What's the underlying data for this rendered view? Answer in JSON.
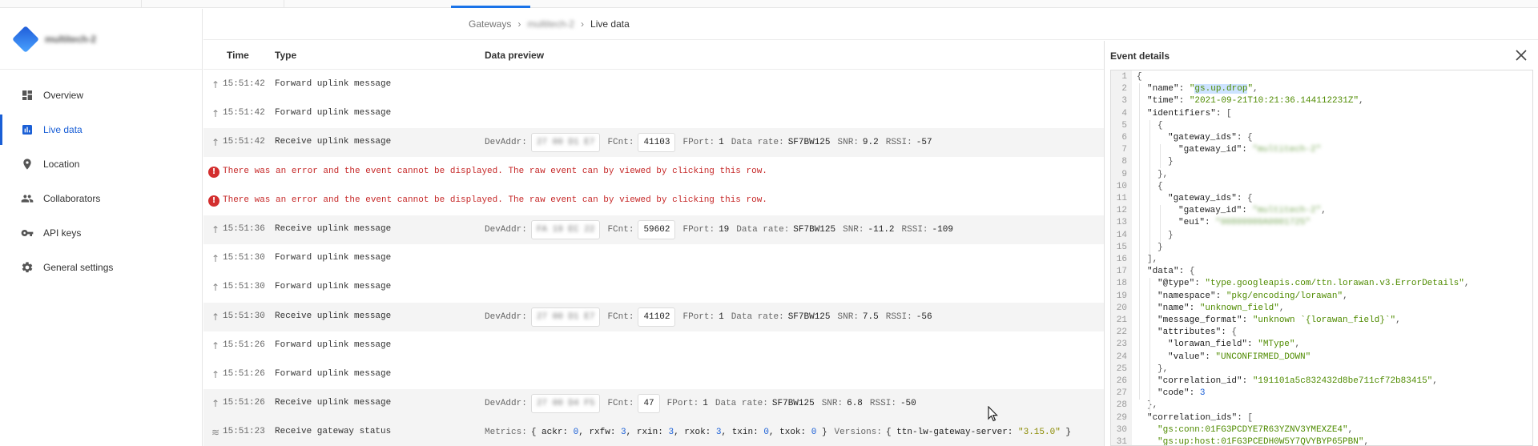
{
  "sidebar": {
    "brand_name": "multitech-2",
    "items": [
      {
        "label": "Overview",
        "icon": "dashboard-icon",
        "active": false
      },
      {
        "label": "Live data",
        "icon": "bar-chart-icon",
        "active": true
      },
      {
        "label": "Location",
        "icon": "location-pin-icon",
        "active": false
      },
      {
        "label": "Collaborators",
        "icon": "people-icon",
        "active": false
      },
      {
        "label": "API keys",
        "icon": "key-icon",
        "active": false
      },
      {
        "label": "General settings",
        "icon": "gear-icon",
        "active": false
      }
    ]
  },
  "breadcrumb": {
    "items": [
      "Gateways",
      "multitech-2",
      "Live data"
    ]
  },
  "table": {
    "headers": {
      "time": "Time",
      "type": "Type",
      "preview": "Data preview"
    },
    "rows": [
      {
        "kind": "event",
        "icon": "arrow-up-icon",
        "time": "15:51:42",
        "type": "Forward uplink message"
      },
      {
        "kind": "event",
        "icon": "arrow-up-icon",
        "time": "15:51:42",
        "type": "Forward uplink message"
      },
      {
        "kind": "uplink",
        "icon": "arrow-up-icon",
        "time": "15:51:42",
        "type": "Receive uplink message",
        "devaddr": "27 00 D1 E7",
        "fcnt": "41103",
        "fport": "1",
        "datarate": "SF7BW125",
        "snr": "9.2",
        "rssi": "-57"
      },
      {
        "kind": "error",
        "text": "There was an error and the event cannot be displayed. The raw event can by viewed by clicking this row."
      },
      {
        "kind": "error",
        "text": "There was an error and the event cannot be displayed. The raw event can by viewed by clicking this row."
      },
      {
        "kind": "uplink",
        "icon": "arrow-up-icon",
        "time": "15:51:36",
        "type": "Receive uplink message",
        "devaddr": "FA 19 EC 22",
        "fcnt": "59602",
        "fport": "19",
        "datarate": "SF7BW125",
        "snr": "-11.2",
        "rssi": "-109"
      },
      {
        "kind": "event",
        "icon": "arrow-up-icon",
        "time": "15:51:30",
        "type": "Forward uplink message"
      },
      {
        "kind": "event",
        "icon": "arrow-up-icon",
        "time": "15:51:30",
        "type": "Forward uplink message"
      },
      {
        "kind": "uplink",
        "icon": "arrow-up-icon",
        "time": "15:51:30",
        "type": "Receive uplink message",
        "devaddr": "27 00 D1 E7",
        "fcnt": "41102",
        "fport": "1",
        "datarate": "SF7BW125",
        "snr": "7.5",
        "rssi": "-56"
      },
      {
        "kind": "event",
        "icon": "arrow-up-icon",
        "time": "15:51:26",
        "type": "Forward uplink message"
      },
      {
        "kind": "event",
        "icon": "arrow-up-icon",
        "time": "15:51:26",
        "type": "Forward uplink message"
      },
      {
        "kind": "uplink",
        "icon": "arrow-up-icon",
        "time": "15:51:26",
        "type": "Receive uplink message",
        "devaddr": "27 00 D4 F5",
        "fcnt": "47",
        "fport": "1",
        "datarate": "SF7BW125",
        "snr": "6.8",
        "rssi": "-50"
      },
      {
        "kind": "status",
        "icon": "wifi-icon",
        "time": "15:51:23",
        "type": "Receive gateway status",
        "metrics": {
          "ackr": "0",
          "rxfw": "3",
          "rxin": "3",
          "rxok": "3",
          "txin": "0",
          "txok": "0"
        },
        "version_key": "ttn-lw-gateway-server",
        "version_value": "\"3.15.0\""
      }
    ],
    "labels": {
      "devaddr": "DevAddr:",
      "fcnt": "FCnt:",
      "fport": "FPort:",
      "datarate": "Data rate:",
      "snr": "SNR:",
      "rssi": "RSSI:",
      "metrics": "Metrics:",
      "versions": "Versions:"
    }
  },
  "event_details": {
    "title": "Event details",
    "lines": [
      {
        "n": "1",
        "indent": 0,
        "parts": [
          [
            "p",
            "{"
          ]
        ]
      },
      {
        "n": "2",
        "indent": 1,
        "parts": [
          [
            "k",
            "\"name\": "
          ],
          [
            "s",
            "\""
          ],
          [
            "hl",
            "gs.up.drop"
          ],
          [
            "s",
            "\""
          ],
          [
            "p",
            ","
          ]
        ]
      },
      {
        "n": "3",
        "indent": 1,
        "parts": [
          [
            "k",
            "\"time\": "
          ],
          [
            "s",
            "\"2021-09-21T10:21:36.144112231Z\""
          ],
          [
            "p",
            ","
          ]
        ]
      },
      {
        "n": "4",
        "indent": 1,
        "parts": [
          [
            "k",
            "\"identifiers\": "
          ],
          [
            "p",
            "["
          ]
        ]
      },
      {
        "n": "5",
        "indent": 2,
        "parts": [
          [
            "p",
            "{"
          ]
        ]
      },
      {
        "n": "6",
        "indent": 3,
        "parts": [
          [
            "k",
            "\"gateway_ids\": "
          ],
          [
            "p",
            "{"
          ]
        ]
      },
      {
        "n": "7",
        "indent": 4,
        "parts": [
          [
            "k",
            "\"gateway_id\": "
          ],
          [
            "bl",
            "\"multitech-2\""
          ]
        ]
      },
      {
        "n": "8",
        "indent": 3,
        "parts": [
          [
            "p",
            "}"
          ]
        ]
      },
      {
        "n": "9",
        "indent": 2,
        "parts": [
          [
            "p",
            "},"
          ]
        ]
      },
      {
        "n": "10",
        "indent": 2,
        "parts": [
          [
            "p",
            "{"
          ]
        ]
      },
      {
        "n": "11",
        "indent": 3,
        "parts": [
          [
            "k",
            "\"gateway_ids\": "
          ],
          [
            "p",
            "{"
          ]
        ]
      },
      {
        "n": "12",
        "indent": 4,
        "parts": [
          [
            "k",
            "\"gateway_id\": "
          ],
          [
            "bl",
            "\"multitech-2\""
          ],
          [
            "p",
            ","
          ]
        ]
      },
      {
        "n": "13",
        "indent": 4,
        "parts": [
          [
            "k",
            "\"eui\": "
          ],
          [
            "bl",
            "\"00800000A0001725\""
          ]
        ]
      },
      {
        "n": "14",
        "indent": 3,
        "parts": [
          [
            "p",
            "}"
          ]
        ]
      },
      {
        "n": "15",
        "indent": 2,
        "parts": [
          [
            "p",
            "}"
          ]
        ]
      },
      {
        "n": "16",
        "indent": 1,
        "parts": [
          [
            "p",
            "],"
          ]
        ]
      },
      {
        "n": "17",
        "indent": 1,
        "parts": [
          [
            "k",
            "\"data\": "
          ],
          [
            "p",
            "{"
          ]
        ]
      },
      {
        "n": "18",
        "indent": 2,
        "parts": [
          [
            "k",
            "\"@type\": "
          ],
          [
            "s",
            "\"type.googleapis.com/ttn.lorawan.v3.ErrorDetails\""
          ],
          [
            "p",
            ","
          ]
        ]
      },
      {
        "n": "19",
        "indent": 2,
        "parts": [
          [
            "k",
            "\"namespace\": "
          ],
          [
            "s",
            "\"pkg/encoding/lorawan\""
          ],
          [
            "p",
            ","
          ]
        ]
      },
      {
        "n": "20",
        "indent": 2,
        "parts": [
          [
            "k",
            "\"name\": "
          ],
          [
            "s",
            "\"unknown_field\""
          ],
          [
            "p",
            ","
          ]
        ]
      },
      {
        "n": "21",
        "indent": 2,
        "parts": [
          [
            "k",
            "\"message_format\": "
          ],
          [
            "s",
            "\"unknown `{lorawan_field}`\""
          ],
          [
            "p",
            ","
          ]
        ]
      },
      {
        "n": "22",
        "indent": 2,
        "parts": [
          [
            "k",
            "\"attributes\": "
          ],
          [
            "p",
            "{"
          ]
        ]
      },
      {
        "n": "23",
        "indent": 3,
        "parts": [
          [
            "k",
            "\"lorawan_field\": "
          ],
          [
            "s",
            "\"MType\""
          ],
          [
            "p",
            ","
          ]
        ]
      },
      {
        "n": "24",
        "indent": 3,
        "parts": [
          [
            "k",
            "\"value\": "
          ],
          [
            "s",
            "\"UNCONFIRMED_DOWN\""
          ]
        ]
      },
      {
        "n": "25",
        "indent": 2,
        "parts": [
          [
            "p",
            "},"
          ]
        ]
      },
      {
        "n": "26",
        "indent": 2,
        "parts": [
          [
            "k",
            "\"correlation_id\": "
          ],
          [
            "s",
            "\"191101a5c832432d8be711cf72b83415\""
          ],
          [
            "p",
            ","
          ]
        ]
      },
      {
        "n": "27",
        "indent": 2,
        "parts": [
          [
            "k",
            "\"code\": "
          ],
          [
            "n",
            "3"
          ]
        ]
      },
      {
        "n": "28",
        "indent": 1,
        "parts": [
          [
            "p",
            "},"
          ]
        ]
      },
      {
        "n": "29",
        "indent": 1,
        "parts": [
          [
            "k",
            "\"correlation_ids\": "
          ],
          [
            "p",
            "["
          ]
        ]
      },
      {
        "n": "30",
        "indent": 2,
        "parts": [
          [
            "s",
            "\"gs:conn:01FG3PCDYE7R63YZNV3YMEXZE4\""
          ],
          [
            "p",
            ","
          ]
        ]
      },
      {
        "n": "31",
        "indent": 2,
        "parts": [
          [
            "s",
            "\"gs:up:host:01FG3PCEDH0W5Y7QVYBYP65PBN\""
          ],
          [
            "p",
            ","
          ]
        ]
      }
    ]
  },
  "colors": {
    "accent": "#1a5fd6",
    "error": "#c62828",
    "json_string": "#4f8b00",
    "json_number": "#1a5fd6"
  }
}
